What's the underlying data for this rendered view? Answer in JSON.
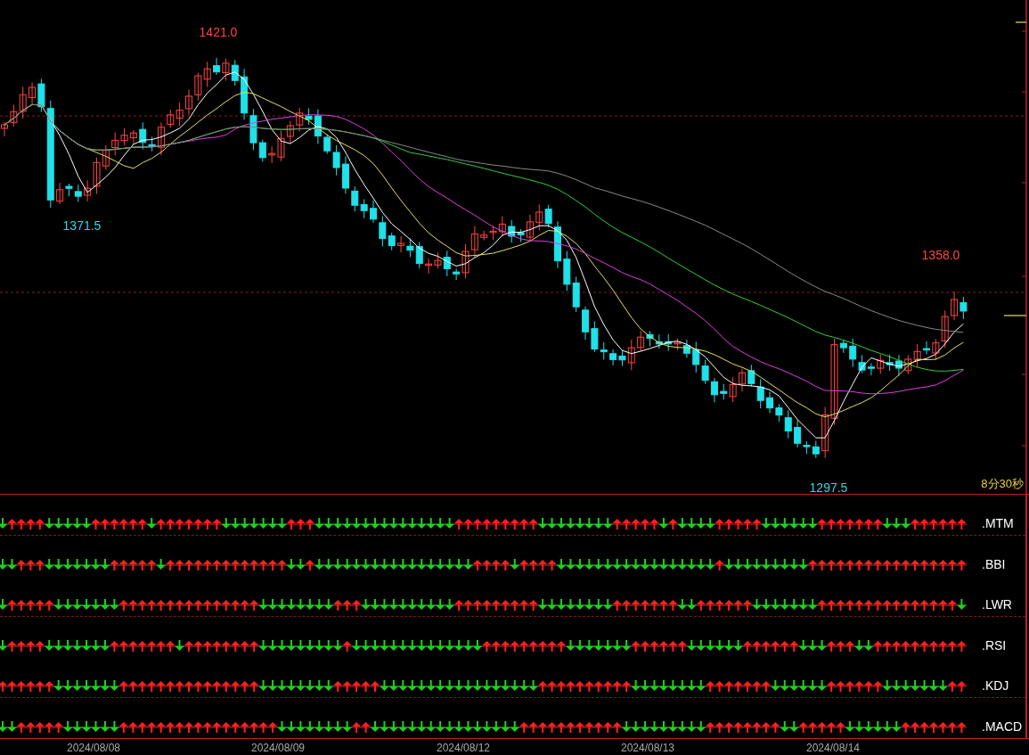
{
  "chart": {
    "annotations": [
      {
        "text": "1421.0",
        "kind": "high"
      },
      {
        "text": "1371.5",
        "kind": "low"
      },
      {
        "text": "1358.0",
        "kind": "high"
      },
      {
        "text": "1297.5",
        "kind": "low"
      }
    ],
    "timer": "8分30秒"
  },
  "indicators": [
    {
      "name": ".MTM"
    },
    {
      "name": ".BBI"
    },
    {
      "name": ".LWR"
    },
    {
      "name": ".RSI"
    },
    {
      "name": ".KDJ"
    },
    {
      "name": ".MACD"
    }
  ],
  "dates": [
    "2024/08/08",
    "2024/08/09",
    "2024/08/12",
    "2024/08/13",
    "2024/08/14"
  ]
}
